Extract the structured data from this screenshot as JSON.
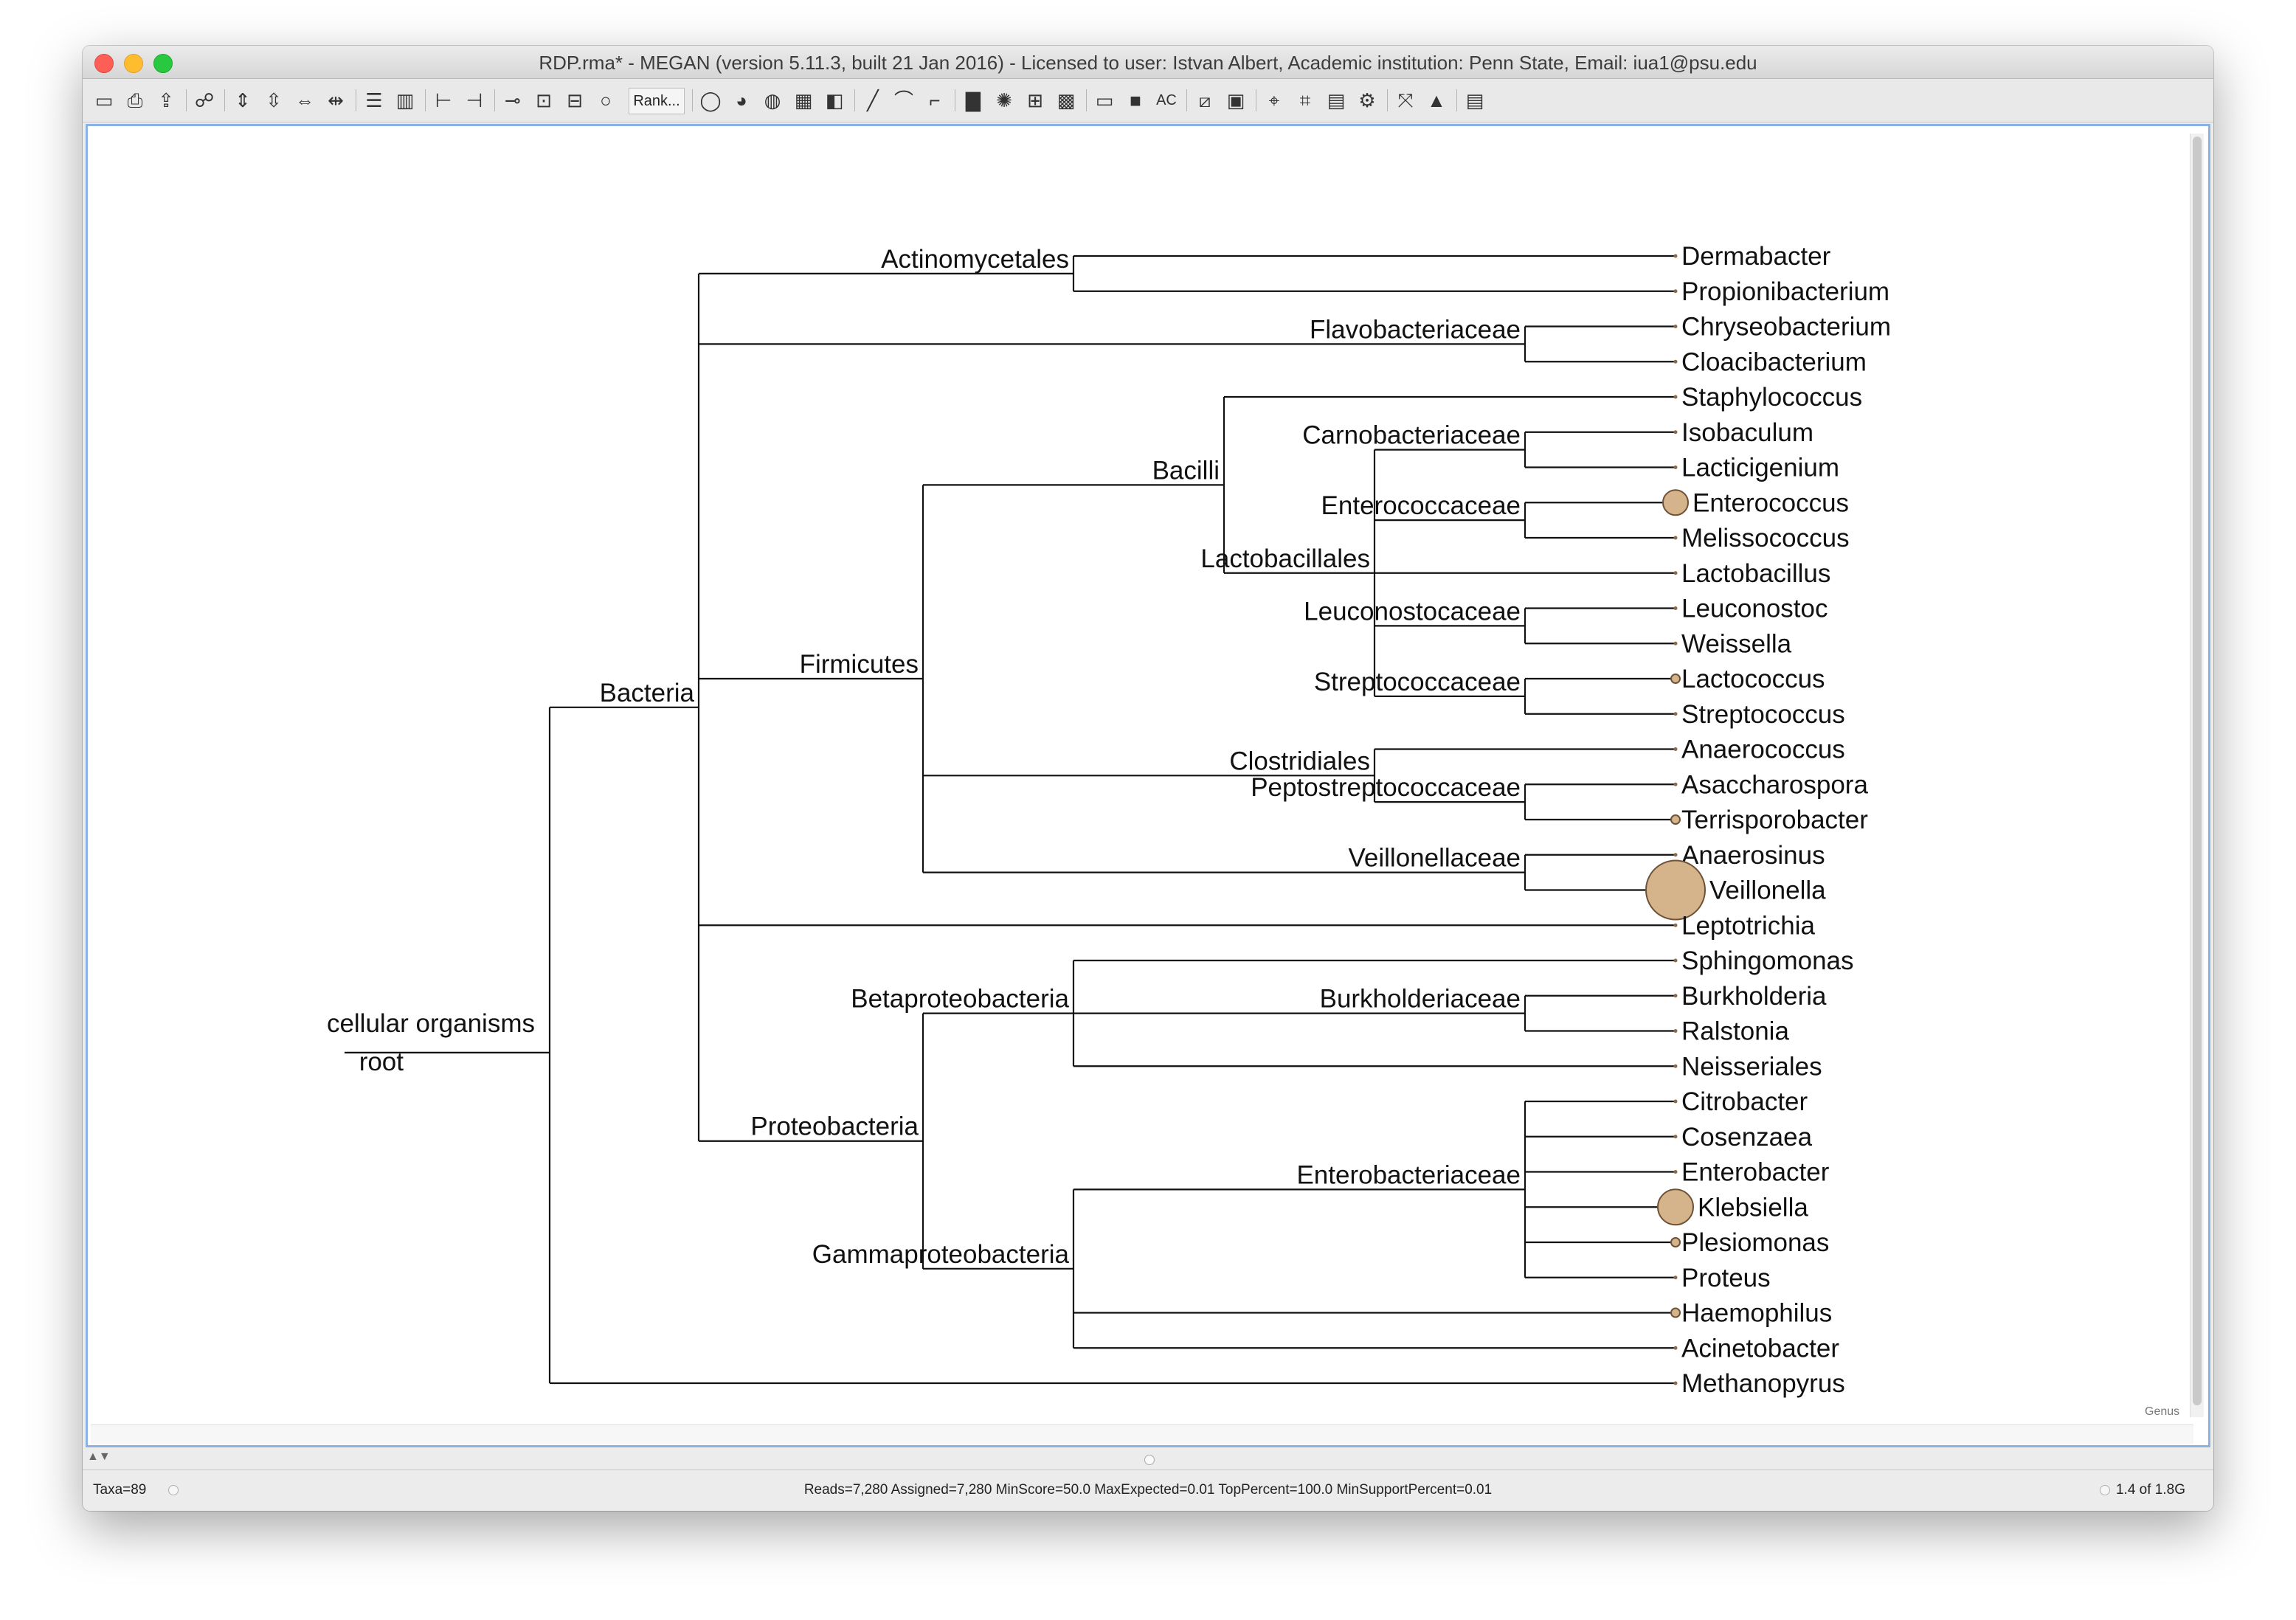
{
  "window": {
    "title": "RDP.rma* - MEGAN (version 5.11.3, built 21 Jan 2016) - Licensed to user: Istvan Albert, Academic institution: Penn State, Email: iua1@psu.edu"
  },
  "toolbar": {
    "rank_button": "Rank...",
    "icons": [
      "open-icon",
      "print-icon",
      "export-icon",
      "find-icon",
      "expand-vertical-icon",
      "contract-vertical-icon",
      "expand-horizontal-icon",
      "contract-horizontal-icon",
      "rows-icon",
      "columns-icon",
      "tree-layout-icon",
      "tree-layout-alt-icon",
      "collapse-icon",
      "uncollapse-icon",
      "subtree-icon",
      "node-circle-icon",
      "pie-chart-icon",
      "heatmap-icon",
      "coxcomb-icon",
      "bars-icon",
      "color-icon",
      "line-icon",
      "curve-icon",
      "angled-icon",
      "bar-chart-icon",
      "word-cloud-icon",
      "compare-icon",
      "grid-icon",
      "ratio-icon",
      "square-icon",
      "ac-icon",
      "no-color-icon",
      "multi-color-icon",
      "inspector-icon",
      "label-inspector-icon",
      "table-icon",
      "settings-icon",
      "compare-samples-icon",
      "fit-icon",
      "navigate-icon",
      "list-icon"
    ]
  },
  "tree": {
    "rank_label": "Genus",
    "root_label": "root",
    "internal_labels": [
      "cellular organisms",
      "Bacteria",
      "Actinomycetales",
      "Flavobacteriaceae",
      "Firmicutes",
      "Bacilli",
      "Lactobacillales",
      "Carnobacteriaceae",
      "Enterococcaceae",
      "Leuconostocaceae",
      "Streptococcaceae",
      "Clostridiales",
      "Peptostreptococcaceae",
      "Veillonellaceae",
      "Proteobacteria",
      "Betaproteobacteria",
      "Burkholderiaceae",
      "Gammaproteobacteria",
      "Enterobacteriaceae"
    ],
    "leaves": [
      {
        "name": "Dermabacter",
        "size": 0
      },
      {
        "name": "Propionibacterium",
        "size": 0
      },
      {
        "name": "Chryseobacterium",
        "size": 0
      },
      {
        "name": "Cloacibacterium",
        "size": 0
      },
      {
        "name": "Staphylococcus",
        "size": 0
      },
      {
        "name": "Isobaculum",
        "size": 0
      },
      {
        "name": "Lacticigenium",
        "size": 0
      },
      {
        "name": "Enterococcus",
        "size": 2
      },
      {
        "name": "Melissococcus",
        "size": 0
      },
      {
        "name": "Lactobacillus",
        "size": 0
      },
      {
        "name": "Leuconostoc",
        "size": 0
      },
      {
        "name": "Weissella",
        "size": 0
      },
      {
        "name": "Lactococcus",
        "size": 1
      },
      {
        "name": "Streptococcus",
        "size": 0
      },
      {
        "name": "Anaerococcus",
        "size": 0
      },
      {
        "name": "Asaccharospora",
        "size": 0
      },
      {
        "name": "Terrisporobacter",
        "size": 1
      },
      {
        "name": "Anaerosinus",
        "size": 0
      },
      {
        "name": "Veillonella",
        "size": 4
      },
      {
        "name": "Leptotrichia",
        "size": 0
      },
      {
        "name": "Sphingomonas",
        "size": 0
      },
      {
        "name": "Burkholderia",
        "size": 0
      },
      {
        "name": "Ralstonia",
        "size": 0
      },
      {
        "name": "Neisseriales",
        "size": 0
      },
      {
        "name": "Citrobacter",
        "size": 0
      },
      {
        "name": "Cosenzaea",
        "size": 0
      },
      {
        "name": "Enterobacter",
        "size": 0
      },
      {
        "name": "Klebsiella",
        "size": 3
      },
      {
        "name": "Plesiomonas",
        "size": 1
      },
      {
        "name": "Proteus",
        "size": 0
      },
      {
        "name": "Haemophilus",
        "size": 1
      },
      {
        "name": "Acinetobacter",
        "size": 0
      },
      {
        "name": "Methanopyrus",
        "size": 0
      }
    ],
    "bubble_color": "#d5b48c"
  },
  "status": {
    "taxa": "Taxa=89",
    "stats": "Reads=7,280 Assigned=7,280 MinScore=50.0 MaxExpected=0.01 TopPercent=100.0 MinSupportPercent=0.01",
    "memory": "1.4 of 1.8G"
  }
}
